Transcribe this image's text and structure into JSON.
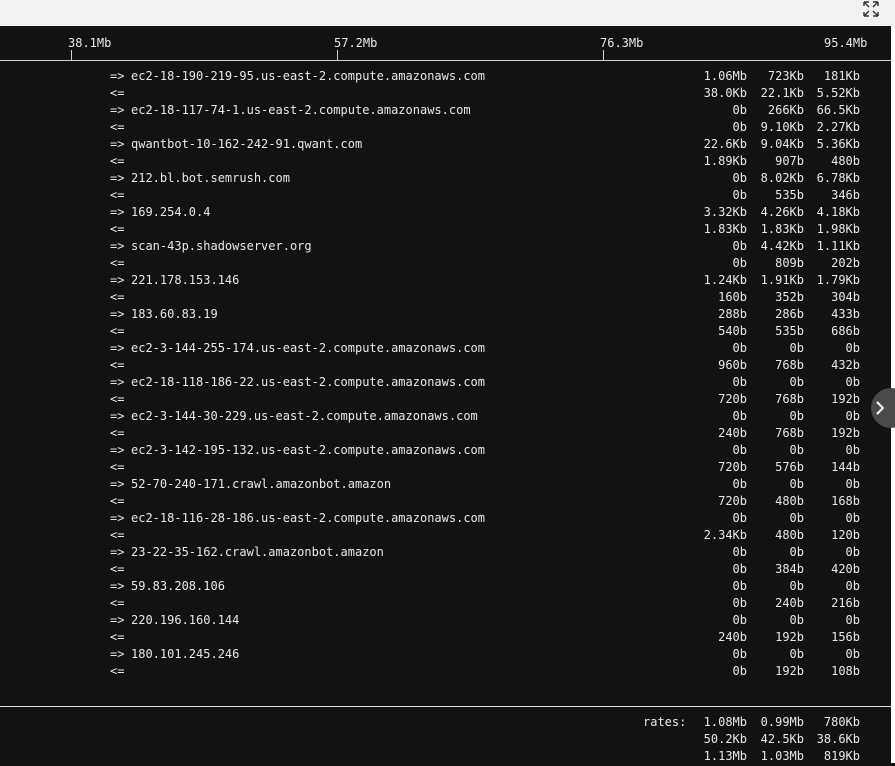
{
  "scale": {
    "labels": [
      "38.1Mb",
      "57.2Mb",
      "76.3Mb",
      "95.4Mb"
    ]
  },
  "flows": [
    {
      "out": {
        "dir": "=>",
        "host": "ec2-18-190-219-95.us-east-2.compute.amazonaws.com",
        "r2": "1.06Mb",
        "r10": "723Kb",
        "r40": "181Kb"
      },
      "in": {
        "dir": "<=",
        "r2": "38.0Kb",
        "r10": "22.1Kb",
        "r40": "5.52Kb"
      }
    },
    {
      "out": {
        "dir": "=>",
        "host": "ec2-18-117-74-1.us-east-2.compute.amazonaws.com",
        "r2": "0b",
        "r10": "266Kb",
        "r40": "66.5Kb"
      },
      "in": {
        "dir": "<=",
        "r2": "0b",
        "r10": "9.10Kb",
        "r40": "2.27Kb"
      }
    },
    {
      "out": {
        "dir": "=>",
        "host": "qwantbot-10-162-242-91.qwant.com",
        "r2": "22.6Kb",
        "r10": "9.04Kb",
        "r40": "5.36Kb"
      },
      "in": {
        "dir": "<=",
        "r2": "1.89Kb",
        "r10": "907b",
        "r40": "480b"
      }
    },
    {
      "out": {
        "dir": "=>",
        "host": "212.bl.bot.semrush.com",
        "r2": "0b",
        "r10": "8.02Kb",
        "r40": "6.78Kb"
      },
      "in": {
        "dir": "<=",
        "r2": "0b",
        "r10": "535b",
        "r40": "346b"
      }
    },
    {
      "out": {
        "dir": "=>",
        "host": "169.254.0.4",
        "r2": "3.32Kb",
        "r10": "4.26Kb",
        "r40": "4.18Kb"
      },
      "in": {
        "dir": "<=",
        "r2": "1.83Kb",
        "r10": "1.83Kb",
        "r40": "1.98Kb"
      }
    },
    {
      "out": {
        "dir": "=>",
        "host": "scan-43p.shadowserver.org",
        "r2": "0b",
        "r10": "4.42Kb",
        "r40": "1.11Kb"
      },
      "in": {
        "dir": "<=",
        "r2": "0b",
        "r10": "809b",
        "r40": "202b"
      }
    },
    {
      "out": {
        "dir": "=>",
        "host": "221.178.153.146",
        "r2": "1.24Kb",
        "r10": "1.91Kb",
        "r40": "1.79Kb"
      },
      "in": {
        "dir": "<=",
        "r2": "160b",
        "r10": "352b",
        "r40": "304b"
      }
    },
    {
      "out": {
        "dir": "=>",
        "host": "183.60.83.19",
        "r2": "288b",
        "r10": "286b",
        "r40": "433b"
      },
      "in": {
        "dir": "<=",
        "r2": "540b",
        "r10": "535b",
        "r40": "686b"
      }
    },
    {
      "out": {
        "dir": "=>",
        "host": "ec2-3-144-255-174.us-east-2.compute.amazonaws.com",
        "r2": "0b",
        "r10": "0b",
        "r40": "0b"
      },
      "in": {
        "dir": "<=",
        "r2": "960b",
        "r10": "768b",
        "r40": "432b"
      }
    },
    {
      "out": {
        "dir": "=>",
        "host": "ec2-18-118-186-22.us-east-2.compute.amazonaws.com",
        "r2": "0b",
        "r10": "0b",
        "r40": "0b"
      },
      "in": {
        "dir": "<=",
        "r2": "720b",
        "r10": "768b",
        "r40": "192b"
      }
    },
    {
      "out": {
        "dir": "=>",
        "host": "ec2-3-144-30-229.us-east-2.compute.amazonaws.com",
        "r2": "0b",
        "r10": "0b",
        "r40": "0b"
      },
      "in": {
        "dir": "<=",
        "r2": "240b",
        "r10": "768b",
        "r40": "192b"
      }
    },
    {
      "out": {
        "dir": "=>",
        "host": "ec2-3-142-195-132.us-east-2.compute.amazonaws.com",
        "r2": "0b",
        "r10": "0b",
        "r40": "0b"
      },
      "in": {
        "dir": "<=",
        "r2": "720b",
        "r10": "576b",
        "r40": "144b"
      }
    },
    {
      "out": {
        "dir": "=>",
        "host": "52-70-240-171.crawl.amazonbot.amazon",
        "r2": "0b",
        "r10": "0b",
        "r40": "0b"
      },
      "in": {
        "dir": "<=",
        "r2": "720b",
        "r10": "480b",
        "r40": "168b"
      }
    },
    {
      "out": {
        "dir": "=>",
        "host": "ec2-18-116-28-186.us-east-2.compute.amazonaws.com",
        "r2": "0b",
        "r10": "0b",
        "r40": "0b"
      },
      "in": {
        "dir": "<=",
        "r2": "2.34Kb",
        "r10": "480b",
        "r40": "120b"
      }
    },
    {
      "out": {
        "dir": "=>",
        "host": "23-22-35-162.crawl.amazonbot.amazon",
        "r2": "0b",
        "r10": "0b",
        "r40": "0b"
      },
      "in": {
        "dir": "<=",
        "r2": "0b",
        "r10": "384b",
        "r40": "420b"
      }
    },
    {
      "out": {
        "dir": "=>",
        "host": "59.83.208.106",
        "r2": "0b",
        "r10": "0b",
        "r40": "0b"
      },
      "in": {
        "dir": "<=",
        "r2": "0b",
        "r10": "240b",
        "r40": "216b"
      }
    },
    {
      "out": {
        "dir": "=>",
        "host": "220.196.160.144",
        "r2": "0b",
        "r10": "0b",
        "r40": "0b"
      },
      "in": {
        "dir": "<=",
        "r2": "240b",
        "r10": "192b",
        "r40": "156b"
      }
    },
    {
      "out": {
        "dir": "=>",
        "host": "180.101.245.246",
        "r2": "0b",
        "r10": "0b",
        "r40": "0b"
      },
      "in": {
        "dir": "<=",
        "r2": "0b",
        "r10": "192b",
        "r40": "108b"
      }
    }
  ],
  "totals": {
    "label": "rates:",
    "rows": [
      {
        "r2": "1.08Mb",
        "r10": "0.99Mb",
        "r40": "780Kb"
      },
      {
        "r2": "50.2Kb",
        "r10": "42.5Kb",
        "r40": "38.6Kb"
      },
      {
        "r2": "1.13Mb",
        "r10": "1.03Mb",
        "r40": "819Kb"
      }
    ]
  },
  "icons": {
    "expand": "expand-icon",
    "next": "chevron-right-icon"
  },
  "colors": {
    "background": "#121212",
    "text": "#e8e8e8",
    "topbar": "#f1f1f1"
  }
}
